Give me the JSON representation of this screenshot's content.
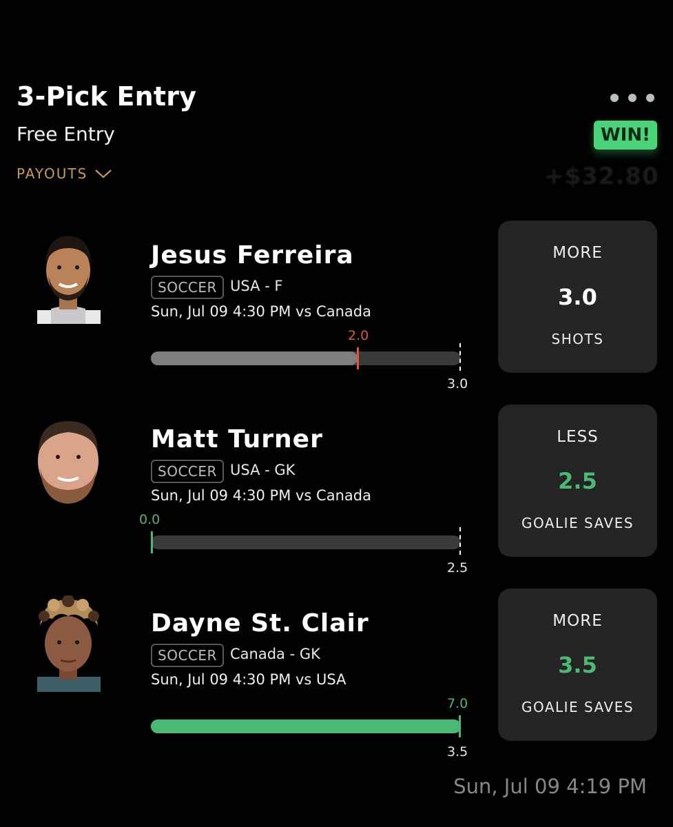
{
  "header": {
    "title": "3-Pick Entry",
    "subtitle": "Free Entry",
    "payouts_label": "PAYOUTS",
    "status_badge": "WIN!",
    "winnings": "+$32.80"
  },
  "colors": {
    "win": "#49d479",
    "miss": "#e0573f",
    "payouts": "#c89a52",
    "card": "#242424"
  },
  "picks": [
    {
      "player": "Jesus Ferreira",
      "sport": "SOCCER",
      "team_pos": "USA - F",
      "game": "Sun, Jul 09 4:30 PM  vs Canada",
      "actual": "2.0",
      "line": "3.0",
      "actual_value": 2.0,
      "line_value": 3.0,
      "direction": "MORE",
      "stat": "SHOTS",
      "result": "miss"
    },
    {
      "player": "Matt Turner",
      "sport": "SOCCER",
      "team_pos": "USA - GK",
      "game": "Sun, Jul 09 4:30 PM  vs Canada",
      "actual": "0.0",
      "line": "2.5",
      "actual_value": 0.0,
      "line_value": 2.5,
      "direction": "LESS",
      "stat": "GOALIE SAVES",
      "result": "hit"
    },
    {
      "player": "Dayne St. Clair",
      "sport": "SOCCER",
      "team_pos": "Canada - GK",
      "game": "Sun, Jul 09 4:30 PM  vs USA",
      "actual": "7.0",
      "line": "3.5",
      "actual_value": 7.0,
      "line_value": 3.5,
      "direction": "MORE",
      "stat": "GOALIE SAVES",
      "result": "hit"
    }
  ],
  "footer": {
    "timestamp": "Sun, Jul 09 4:19 PM"
  }
}
